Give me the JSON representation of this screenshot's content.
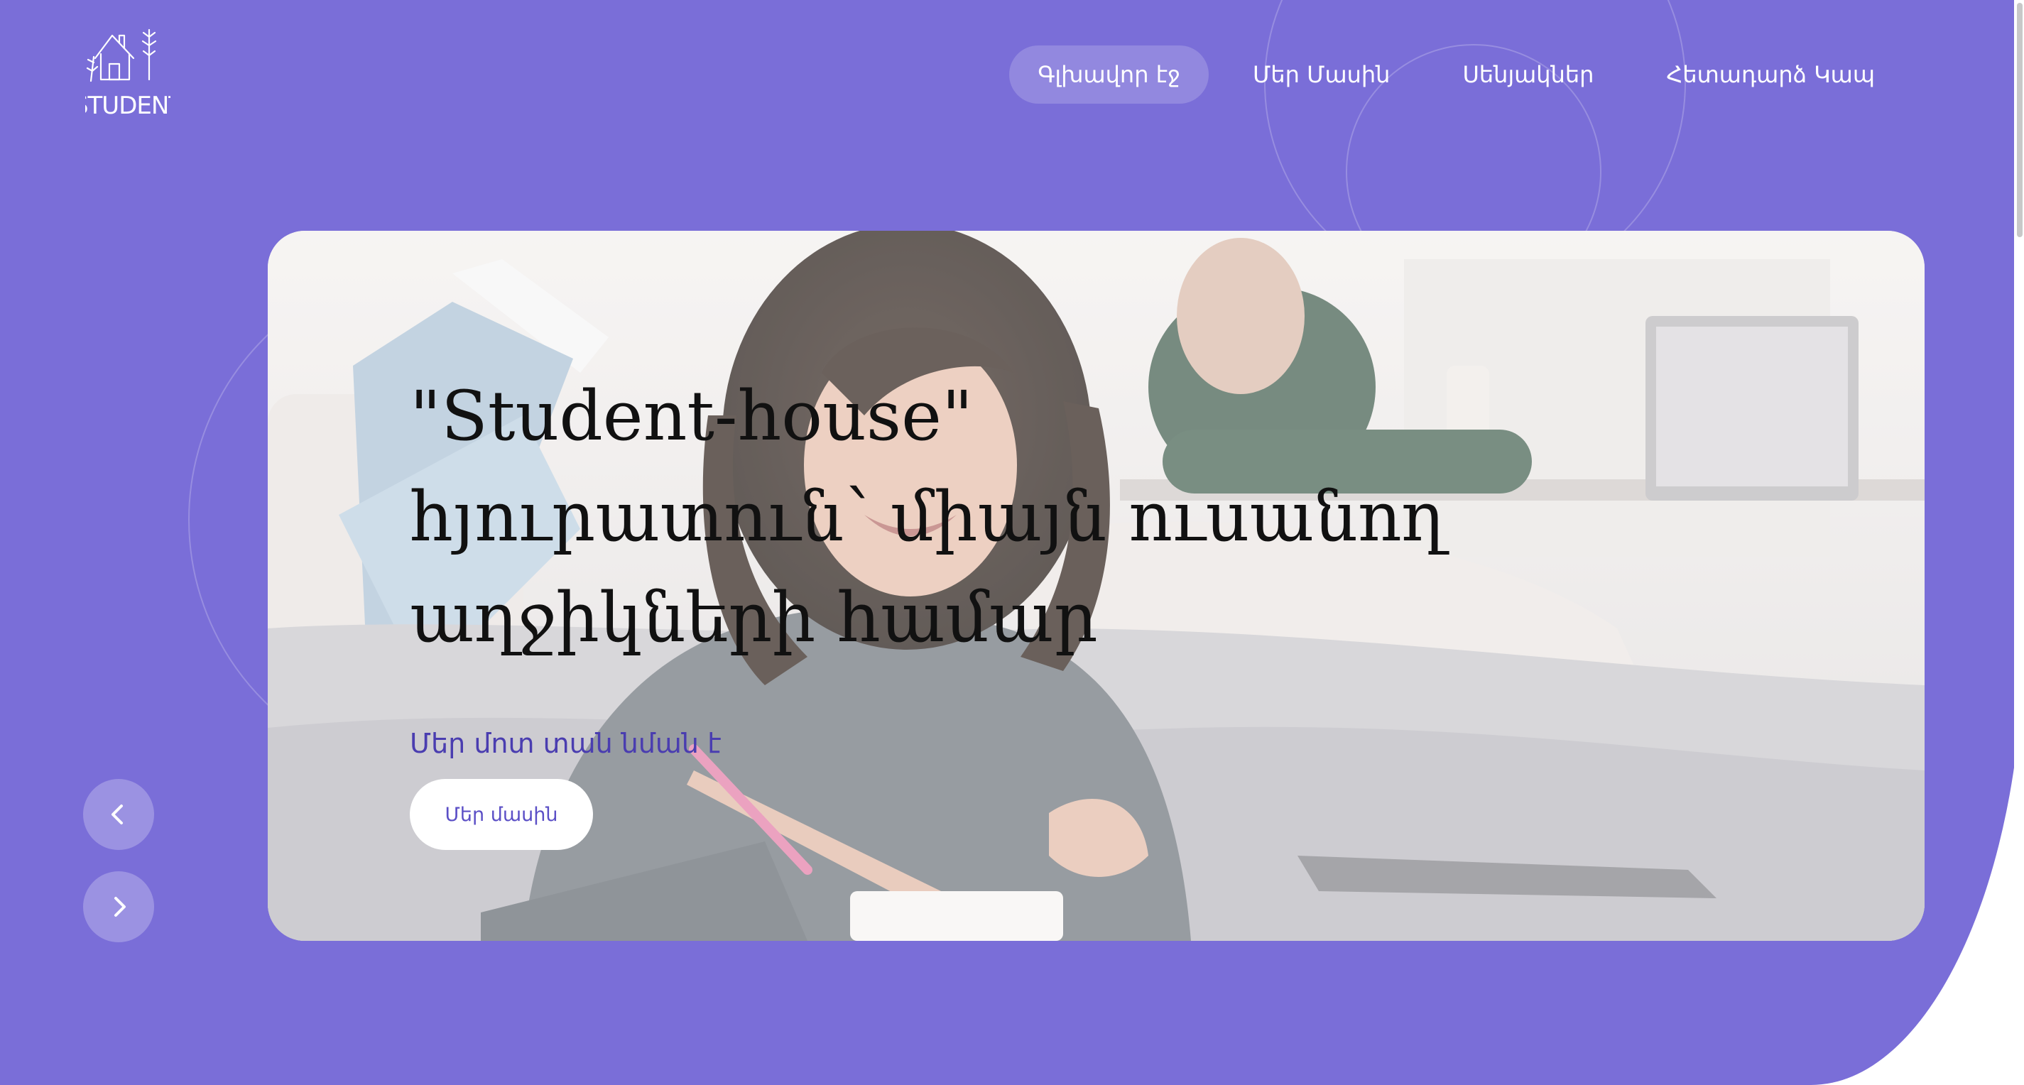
{
  "brand": {
    "logo_text": "STUDENT"
  },
  "nav": {
    "items": [
      {
        "label": "Գլխավոր էջ",
        "active": true
      },
      {
        "label": "Մեր Մասին",
        "active": false
      },
      {
        "label": "Սենյակներ",
        "active": false
      },
      {
        "label": "Հետադարձ Կապ",
        "active": false
      }
    ]
  },
  "hero": {
    "title_line_1": "\"Student-house\"",
    "title_line_2": "հյուրատուն՝ միայն ուսանող",
    "title_line_3": "աղջիկների համար",
    "subtitle": "Մեր մոտ տան նման է",
    "cta_label": "Մեր մասին"
  },
  "slider": {
    "prev_icon": "chevron-left-icon",
    "next_icon": "chevron-right-icon"
  },
  "colors": {
    "background": "#7a6ed8",
    "cta_text": "#5b4fc6",
    "subtitle": "#4a3db0"
  }
}
